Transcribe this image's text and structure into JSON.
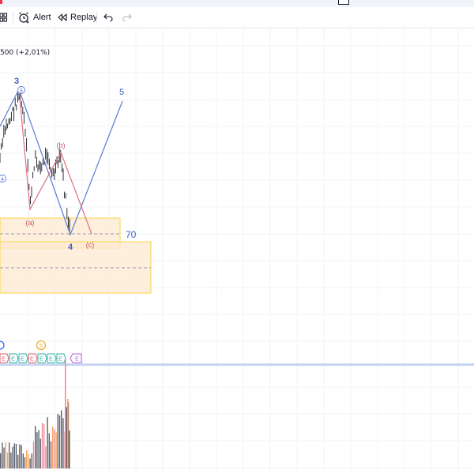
{
  "toolbar": {
    "alert_label": "Alert",
    "replay_label": "Replay"
  },
  "legend": {
    "change_text": "500 (+2,01%)"
  },
  "wave_labels": {
    "w3": "3",
    "w4": "4",
    "w5": "5",
    "a": "(a)",
    "b": "(b)",
    "c": "(c)",
    "circle5_top": "5",
    "circle4": "4",
    "circle5_bottom": "5",
    "target": "70"
  },
  "colors": {
    "wave_blue": "#5b7bd5",
    "wave_red": "#e0707a",
    "zone_fill": "#fde9d2",
    "zone_border": "#f7d44a",
    "volume_orange": "#f5a45a",
    "volume_pink": "#f28a9a",
    "volume_dark": "#5d606b",
    "separator": "#c5d5f3"
  }
}
